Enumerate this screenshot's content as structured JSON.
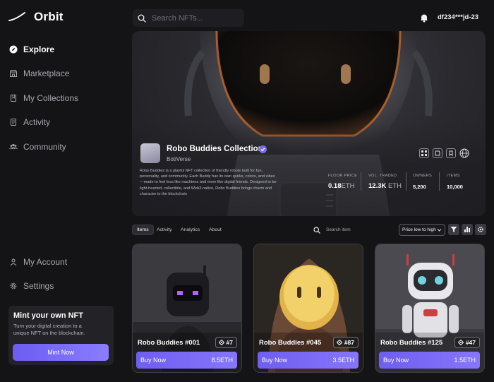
{
  "app": {
    "name": "Orbit"
  },
  "sidebar": {
    "nav": [
      {
        "label": "Explore",
        "icon": "compass-icon",
        "active": true
      },
      {
        "label": "Marketplace",
        "icon": "store-icon",
        "active": false
      },
      {
        "label": "My Collections",
        "icon": "bookmark-icon",
        "active": false
      },
      {
        "label": "Activity",
        "icon": "document-icon",
        "active": false
      },
      {
        "label": "Community",
        "icon": "people-icon",
        "active": false
      }
    ],
    "bottom_nav": [
      {
        "label": "My Account",
        "icon": "user-icon"
      },
      {
        "label": "Settings",
        "icon": "gear-icon"
      }
    ],
    "mint": {
      "title": "Mint your own NFT",
      "description": "Turn your digital creation to a unique NFT on the blockchain.",
      "button": "Mint Now"
    }
  },
  "topbar": {
    "search_placeholder": "Search NFTs...",
    "username": "df234***jd-23"
  },
  "collection": {
    "title": "Robo Buddies Collection",
    "creator": "BotiVerse",
    "description": "Robo Buddies is a playful NFT collection of friendly robots built for fun, personality, and community. Each Buddy has its own quirks, colors, and vibes—made to feel less like machines and more like digital friends. Designed to be light-hearted, collectible, and Web3-native, Robo Buddies brings charm and character to the blockchain",
    "stats": {
      "floor_label": "FLOOR PRICE",
      "floor_value": "0.18",
      "floor_unit": "ETH",
      "vol_label": "VOL. TRADED",
      "vol_value": "12.3K",
      "vol_unit": "ETH",
      "owners_label": "OWNERS",
      "owners_value": "5,200",
      "items_label": "ITEMS",
      "items_value": "10,000"
    }
  },
  "tabs": [
    "Items",
    "Activity",
    "Analytics",
    "About"
  ],
  "filter": {
    "search_placeholder": "Search item",
    "sort_selected": "Price low to high"
  },
  "nfts": [
    {
      "name": "Robo Buddies #001",
      "rank": "#7",
      "buy_label": "Buy Now",
      "price": "8.5ETH"
    },
    {
      "name": "Robo Buddies #045",
      "rank": "#87",
      "buy_label": "Buy Now",
      "price": "3.5ETH"
    },
    {
      "name": "Robo Buddies #125",
      "rank": "#47",
      "buy_label": "Buy Now",
      "price": "1.5ETH"
    }
  ],
  "colors": {
    "background": "#141416",
    "accent": "#7a6cf6",
    "card_border": "#3e3e46",
    "verified": "#7a6cf6"
  }
}
